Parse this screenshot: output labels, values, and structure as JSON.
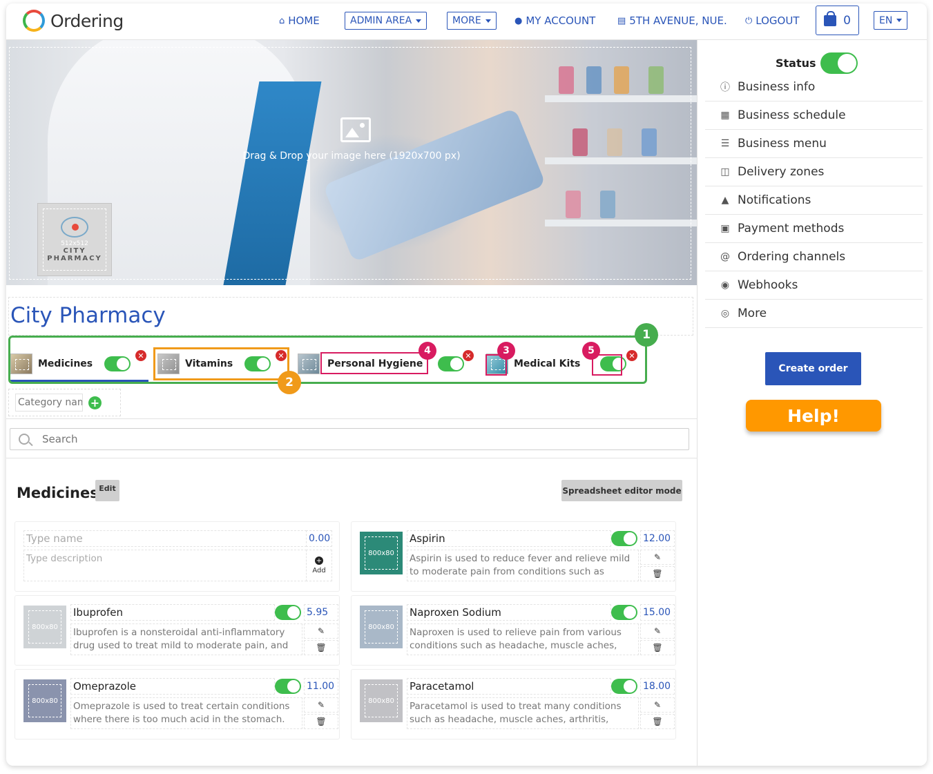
{
  "app": {
    "logo_text": "Ordering"
  },
  "nav": {
    "home": "HOME",
    "admin_area": "ADMIN AREA",
    "more": "MORE",
    "my_account": "MY ACCOUNT",
    "location": "5TH AVENUE, NUE...",
    "logout": "LOGOUT",
    "cart_count": "0",
    "language": "EN"
  },
  "banner": {
    "drop_text": "Drag & Drop your image here (1920x700 px)",
    "logo_size": "512x512",
    "logo_line1": "CITY",
    "logo_line2": "PHARMACY"
  },
  "business": {
    "name": "City Pharmacy"
  },
  "categories": [
    {
      "name": "Medicines",
      "enabled": true
    },
    {
      "name": "Vitamins",
      "enabled": true
    },
    {
      "name": "Personal Hygiene",
      "enabled": true
    },
    {
      "name": "Medical Kits",
      "enabled": true
    }
  ],
  "new_category": {
    "placeholder": "Category name"
  },
  "annotations": [
    "1",
    "2",
    "3",
    "4",
    "5"
  ],
  "search": {
    "placeholder": "Search"
  },
  "section": {
    "title": "Medicines",
    "edit_label": "Edit",
    "spreadsheet_label": "Spreadsheet editor mode"
  },
  "new_product": {
    "name_placeholder": "Type name",
    "desc_placeholder": "Type description",
    "price": "0.00",
    "add_label": "Add"
  },
  "products": [
    {
      "name": "Aspirin",
      "price": "12.00",
      "img_label": "800x80",
      "desc": "Aspirin is used to reduce fever and relieve mild to moderate pain from conditions such as"
    },
    {
      "name": "Ibuprofen",
      "price": "5.95",
      "img_label": "800x80",
      "desc": "Ibuprofen is a nonsteroidal anti-inflammatory drug used to treat mild to moderate pain, and"
    },
    {
      "name": "Naproxen Sodium",
      "price": "15.00",
      "img_label": "800x80",
      "desc": "Naproxen is used to relieve pain from various conditions such as headache, muscle aches,"
    },
    {
      "name": "Omeprazole",
      "price": "11.00",
      "img_label": "800x80",
      "desc": "Omeprazole is used to treat certain conditions where there is too much acid in the stomach."
    },
    {
      "name": "Paracetamol",
      "price": "18.00",
      "img_label": "800x80",
      "desc": "Paracetamol is used to treat many conditions such as headache, muscle aches, arthritis,"
    }
  ],
  "sidebar": {
    "status_label": "Status",
    "items": [
      {
        "label": "Business info",
        "icon": "info-icon"
      },
      {
        "label": "Business schedule",
        "icon": "calendar-icon"
      },
      {
        "label": "Business menu",
        "icon": "menu-icon"
      },
      {
        "label": "Delivery zones",
        "icon": "map-icon"
      },
      {
        "label": "Notifications",
        "icon": "bell-icon"
      },
      {
        "label": "Payment methods",
        "icon": "money-icon"
      },
      {
        "label": "Ordering channels",
        "icon": "at-icon"
      },
      {
        "label": "Webhooks",
        "icon": "globe-icon"
      },
      {
        "label": "More",
        "icon": "target-icon"
      }
    ],
    "create_order": "Create order",
    "help": "Help!"
  },
  "colors": {
    "primary": "#2a55b8",
    "success": "#3ebd4d",
    "help": "#ff9800",
    "danger": "#d62b2b",
    "annotation_pink": "#d81b60",
    "annotation_green": "#46ad4e",
    "annotation_orange": "#f09a1a"
  }
}
